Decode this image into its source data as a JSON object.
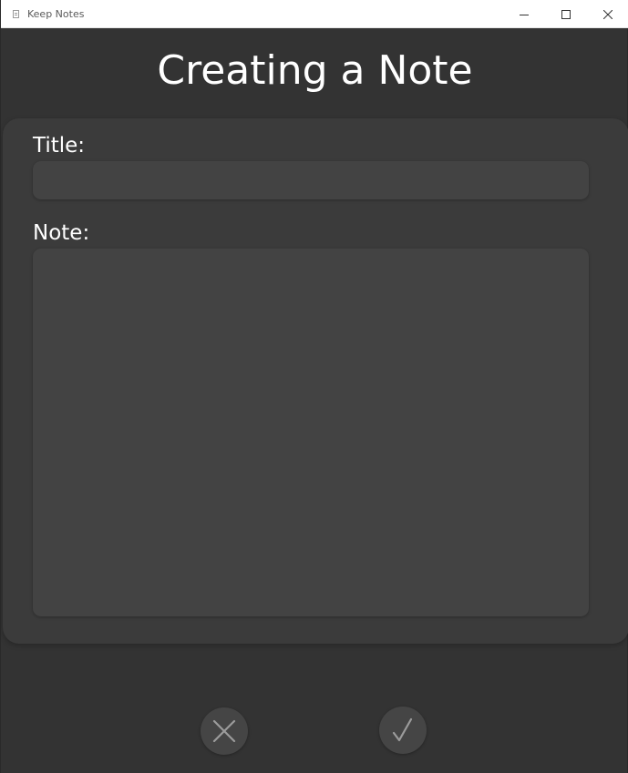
{
  "window": {
    "title": "Keep Notes",
    "icon": "notepad-icon",
    "controls": [
      "minimize-icon",
      "maximize-icon",
      "close-icon"
    ]
  },
  "page": {
    "heading": "Creating a Note"
  },
  "form": {
    "title_label": "Title:",
    "title_value": "",
    "note_label": "Note:",
    "note_value": ""
  },
  "actions": {
    "cancel_icon": "x-icon",
    "confirm_icon": "check-icon"
  },
  "colors": {
    "background": "#333333",
    "card": "#3b3b3b",
    "field": "#434343",
    "text": "#ffffff",
    "icon": "#9b9b9b"
  }
}
